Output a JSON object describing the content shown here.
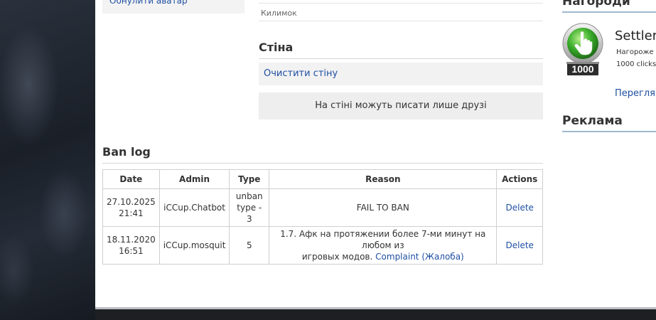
{
  "profile": {
    "reset_avatar_label": "Обнулити аватар",
    "field_label": "Килимок"
  },
  "wall": {
    "title": "Стіна",
    "clear_label": "Очистити стіну",
    "notice": "На стіні можуть писати лише друзі"
  },
  "ban_log": {
    "title": "Ban log",
    "headers": [
      "Date",
      "Admin",
      "Type",
      "Reason",
      "Actions"
    ],
    "rows": [
      {
        "date": "27.10.2025",
        "time": "21:41",
        "admin": "iCCup.Chatbot",
        "type_line1": "unban",
        "type_line2": "type - 3",
        "reason_line1": "FAIL TO BAN",
        "reason_line2": "",
        "reason_link": "",
        "action": "Delete"
      },
      {
        "date": "18.11.2020",
        "time": "16:51",
        "admin": "iCCup.mosquit",
        "type_line1": "5",
        "type_line2": "",
        "reason_line1": "1.7. Афк на протяжении более 7-ми минут на любом из",
        "reason_line2": "игровых модов.",
        "reason_link": "Complaint (Жалоба)",
        "action": "Delete"
      }
    ]
  },
  "sidebar": {
    "awards_title": "Нагороди",
    "award": {
      "name": "Settler",
      "line1": "Нагороже",
      "line2": "1000 clicks",
      "badge_number": "1000",
      "more_label": "Переглян"
    },
    "ads_title": "Реклама"
  },
  "colors": {
    "link": "#1f4fa3",
    "badge_green": "#3cae2c",
    "badge_plate": "#2d2d2d"
  }
}
